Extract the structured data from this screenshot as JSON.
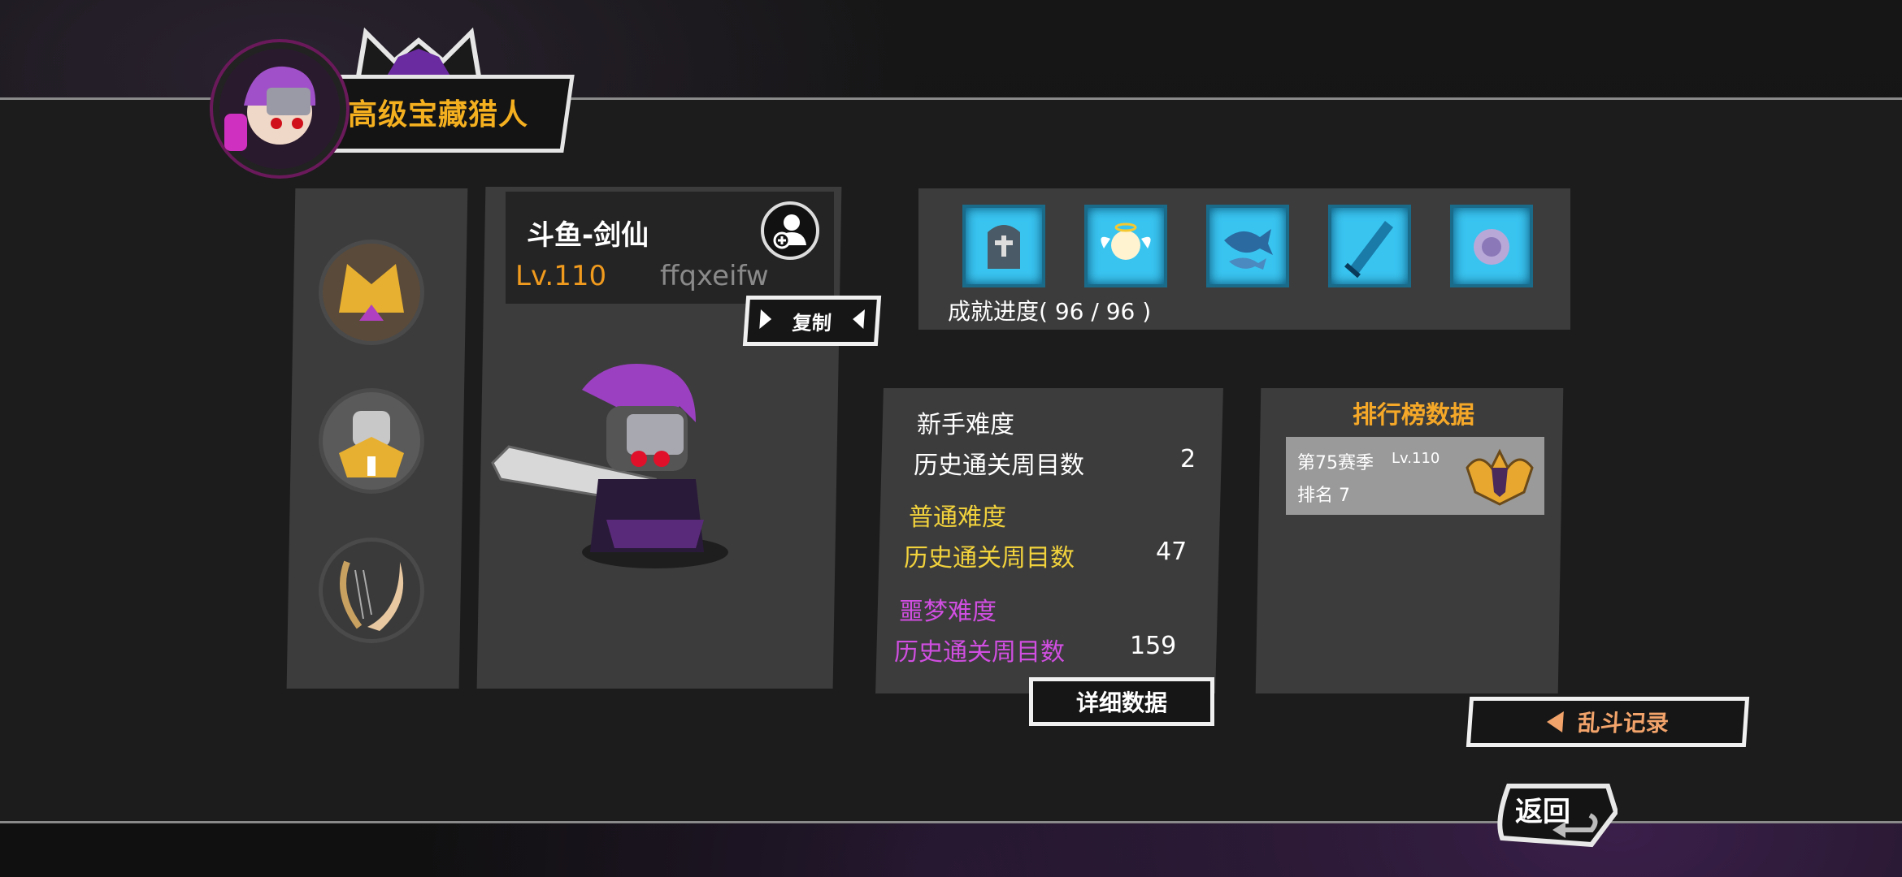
{
  "header": {
    "title": "高级宝藏猎人"
  },
  "player": {
    "name": "斗鱼-剑仙",
    "level": "Lv.110",
    "id": "ffqxeifw",
    "copy_label": "复制"
  },
  "achievements": {
    "icons": [
      "tombstone-icon",
      "angel-icon",
      "fish-icon",
      "crystal-sword-icon",
      "spirit-icon"
    ],
    "progress_label": "成就进度( 96 / 96 )"
  },
  "difficulty": {
    "novice": {
      "title": "新手难度",
      "label": "历史通关周目数",
      "value": "2"
    },
    "normal": {
      "title": "普通难度",
      "label": "历史通关周目数",
      "value": "47"
    },
    "nightmare": {
      "title": "噩梦难度",
      "label": "历史通关周目数",
      "value": "159"
    },
    "details_label": "详细数据"
  },
  "leaderboard": {
    "title": "排行榜数据",
    "season": "第75赛季",
    "season_level": "Lv.110",
    "rank": "排名 7"
  },
  "buttons": {
    "brawl_record": "乱斗记录",
    "back": "返回"
  },
  "colors": {
    "title_gold": "#f5b020",
    "level_orange": "#f09a1e",
    "normal_yellow": "#f2d23c",
    "nightmare_purple": "#d04ee0",
    "achievement_blue": "#39c4f0",
    "brawl_arrow": "#f2a36a"
  }
}
